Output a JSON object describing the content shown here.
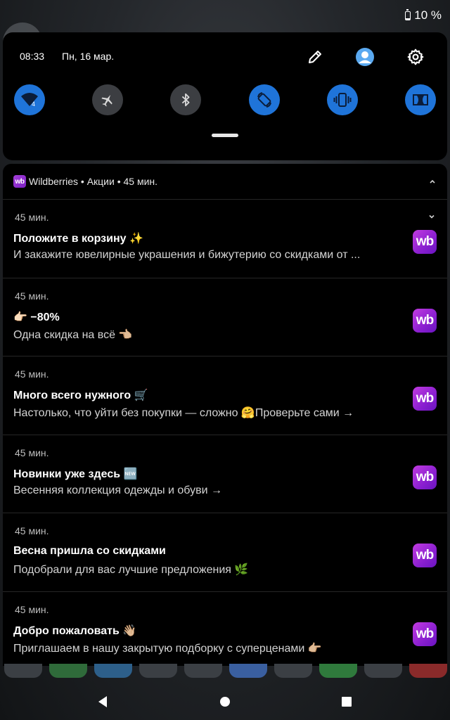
{
  "status_bar": {
    "battery_text": "10 %",
    "battery_level": 0.1
  },
  "quick_settings": {
    "time": "08:33",
    "date": "Пн, 16 мар.",
    "actions": [
      {
        "icon": "pencil-icon"
      },
      {
        "icon": "user-avatar-icon"
      },
      {
        "icon": "gear-icon"
      }
    ],
    "tiles": [
      {
        "icon": "wifi-icon",
        "badge": "4",
        "state": "on"
      },
      {
        "icon": "airplane-mode-icon",
        "state": "off"
      },
      {
        "icon": "bluetooth-icon",
        "state": "off"
      },
      {
        "icon": "auto-rotate-icon",
        "state": "on"
      },
      {
        "icon": "vibrate-icon",
        "state": "on"
      },
      {
        "icon": "dolby-icon",
        "state": "on"
      }
    ],
    "colors": {
      "tile_on": "#1f74d9",
      "tile_off": "#3c3e42"
    }
  },
  "notification_group": {
    "app_icon_text": "wb",
    "header": "Wildberries • Акции • 45 мин.",
    "app_icon_label": "wb",
    "notifications": [
      {
        "time": "45 мин.",
        "title": "Положите в корзину ✨",
        "text": "И закажите ювелирные украшения и бижутерию со скидками от ..."
      },
      {
        "time": "45 мин.",
        "title": "👉🏻 −80%",
        "text": "Одна скидка на всё 👈🏼"
      },
      {
        "time": "45 мин.",
        "title": "Много всего нужного 🛒",
        "text": "Настолько, что уйти без покупки — сложно 🤗Проверьте сами →"
      },
      {
        "time": "45 мин.",
        "title": "Новинки уже здесь 🆕",
        "text": "Весенняя коллекция одежды и обуви →"
      },
      {
        "time": "45 мин.",
        "title": "Весна пришла со скидками",
        "text": "Подобрали для вас лучшие предложения 🌿"
      },
      {
        "time": "45 мин.",
        "title": "Добро пожаловать 👋🏼",
        "text": "Приглашаем в нашу закрытую подборку с суперценами 👉🏼"
      }
    ],
    "brand_color": "#a43fd8"
  },
  "navigation": {
    "buttons": [
      {
        "icon": "back-icon"
      },
      {
        "icon": "home-icon"
      },
      {
        "icon": "recents-icon"
      }
    ]
  }
}
